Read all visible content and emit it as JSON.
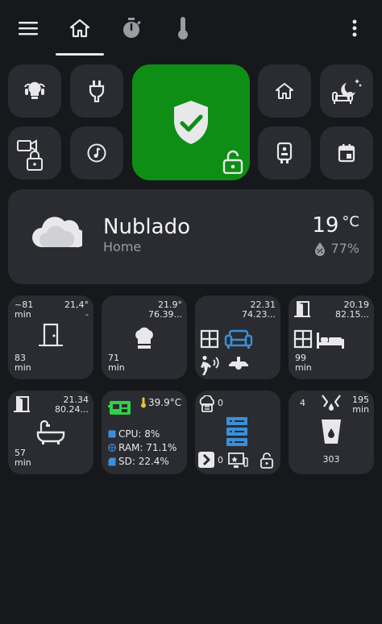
{
  "colors": {
    "background": "#16181c",
    "tile": "#2a2c31",
    "security_green": "#0e8e14",
    "accent_blue": "#3b8fd9",
    "text": "#e8e8ea",
    "muted": "#9a9ca2",
    "cpu_green": "#2fd14a",
    "temp_yellow": "#e8c23a"
  },
  "topbar": {
    "icons": [
      "menu-icon",
      "home-icon",
      "timer-icon",
      "thermometer-icon",
      "more-vert-icon"
    ]
  },
  "weather": {
    "condition": "Nublado",
    "location": "Home",
    "temperature": "19",
    "unit": "°C",
    "humidity": "77%"
  },
  "rooms": [
    {
      "id": "entrance",
      "top_left": "~81\nmin",
      "top_right": "21,4°\n-",
      "bottom_left": "83\nmin"
    },
    {
      "id": "kitchen",
      "top_right": "21.9°\n76.39...",
      "bottom_left": "71\nmin"
    },
    {
      "id": "living",
      "top_right": "22.31\n74.23..."
    },
    {
      "id": "bedroom",
      "top_right": "20.19\n82.15...",
      "bottom_left": "99\nmin"
    },
    {
      "id": "bathroom",
      "top_right": "21.34\n80.24...",
      "bottom_left": "57\nmin"
    },
    {
      "id": "system",
      "temp": "39.9°C",
      "cpu": "CPU: 8%",
      "ram": "RAM: 71.1%",
      "sd": "SD: 22.4%"
    },
    {
      "id": "server",
      "cloud_count": "0",
      "media_count": "0"
    },
    {
      "id": "water",
      "top_left": "4",
      "top_right": "195\nmin",
      "bottom_center": "303"
    }
  ]
}
